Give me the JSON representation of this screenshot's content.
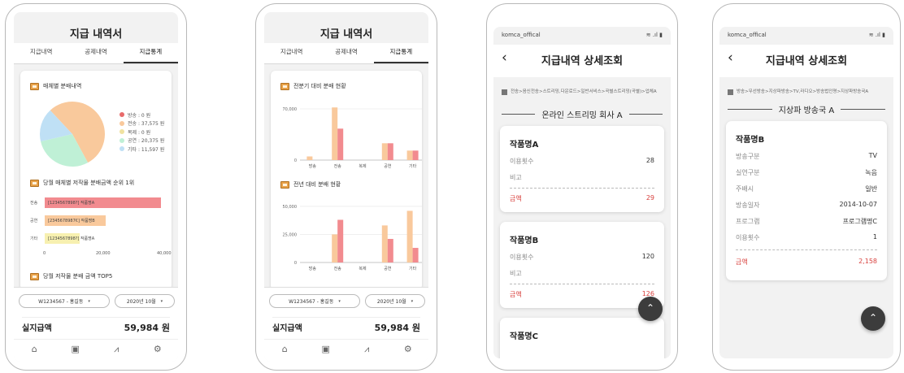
{
  "colors": {
    "accent_red": "#d8413e",
    "bar_orange": "#f9c99c",
    "bar_pink": "#f28b8f",
    "pie_red": "#e86a6a",
    "pie_orange": "#f9c99c",
    "pie_green": "#bff0d6",
    "pie_blue": "#bfe0f5",
    "fab": "#3c3c3c"
  },
  "stats_screen": {
    "title": "지급 내역서",
    "tabs": [
      "지급내역",
      "공제내역",
      "지급통계"
    ],
    "active_tab": "지급통계",
    "footer": {
      "member_select": "W1234567 - 홍길동",
      "month_select": "2020년 10월",
      "total_label": "실지급액",
      "total_value": "59,984 원"
    },
    "nav_icons": [
      "home-icon",
      "document-icon",
      "chart-icon",
      "gear-icon"
    ]
  },
  "stats_a": {
    "sec1": "매체별 분배내역",
    "sec2": "당월 매체별 저작물 분배금액 순위 1위",
    "sec3": "당월 저작물 분배 금액 TOP5",
    "pie_legend": [
      "방송 : 0 원",
      "전송 : 37,575 원",
      "복제 : 0 원",
      "공연 : 20,375 원",
      "기타 : 11,597 원"
    ],
    "hbars": [
      {
        "label": "전송",
        "text": "[1234567898?] 작품명A"
      },
      {
        "label": "공연",
        "text": "[2345678987€] 작품명B"
      },
      {
        "label": "기타",
        "text": "[1234567898?] 작품명A"
      }
    ],
    "hbar_ticks": [
      "0",
      "20,000",
      "40,000"
    ]
  },
  "stats_b": {
    "sec1": "전분기 대비 분배 현황",
    "sec2": "전년 대비 분배 현황",
    "chart1_ticks": [
      "70,000",
      "0"
    ],
    "chart2_ticks": [
      "50,000",
      "25,000",
      "0"
    ],
    "categories": [
      "방송",
      "전송",
      "복제",
      "공연",
      "기타"
    ]
  },
  "chart_data": [
    {
      "type": "pie",
      "title": "매체별 분배내역",
      "categories": [
        "방송",
        "전송",
        "복제",
        "공연",
        "기타"
      ],
      "values": [
        0,
        37575,
        0,
        20375,
        11597
      ]
    },
    {
      "type": "bar",
      "orientation": "horizontal",
      "title": "당월 매체별 저작물 분배금액 순위 1위",
      "categories": [
        "전송",
        "공연",
        "기타"
      ],
      "values": [
        38000,
        20000,
        11500
      ],
      "xlim": [
        0,
        40000
      ]
    },
    {
      "type": "bar",
      "title": "전분기 대비 분배 현황",
      "categories": [
        "방송",
        "전송",
        "복제",
        "공연",
        "기타"
      ],
      "series": [
        {
          "values": [
            5000,
            72000,
            0,
            23000,
            13000
          ]
        },
        {
          "values": [
            0,
            43000,
            0,
            23000,
            13000
          ]
        }
      ],
      "ylim": [
        0,
        80000
      ]
    },
    {
      "type": "bar",
      "title": "전년 대비 분배 현황",
      "categories": [
        "방송",
        "전송",
        "복제",
        "공연",
        "기타"
      ],
      "series": [
        {
          "values": [
            0,
            25000,
            0,
            33000,
            46000
          ]
        },
        {
          "values": [
            0,
            38000,
            0,
            21000,
            13000
          ]
        }
      ],
      "ylim": [
        0,
        55000
      ]
    }
  ],
  "detail_common": {
    "status_left": "komca_offical",
    "status_right": "≋ .ıl ▮",
    "title": "지급내역 상세조회",
    "back": "‹",
    "fab": "⌃"
  },
  "detail_a": {
    "crumb": "전송>음신전송>스트리밍,다운로드>일반서비스>곡별스트리밍(곡별)>업체A",
    "company": "온라인 스트리밍 회사 A",
    "cards": [
      {
        "title": "작품명A",
        "rows": [
          {
            "k": "이용횟수",
            "v": "28"
          },
          {
            "k": "비고",
            "v": ""
          }
        ],
        "amount_label": "금액",
        "amount": "29"
      },
      {
        "title": "작품명B",
        "rows": [
          {
            "k": "이용횟수",
            "v": "120"
          },
          {
            "k": "비고",
            "v": ""
          }
        ],
        "amount_label": "금액",
        "amount": "126"
      }
    ],
    "partial_card_title": "작품명C"
  },
  "detail_b": {
    "crumb": "방송>무선방송>지상파방송>TV,라디오>방송법인명>지상파방송국A",
    "company": "지상파 방송국 A",
    "card": {
      "title": "작품명B",
      "rows": [
        {
          "k": "방송구분",
          "v": "TV"
        },
        {
          "k": "실연구분",
          "v": "녹음"
        },
        {
          "k": "주배시",
          "v": "일반"
        },
        {
          "k": "방송일자",
          "v": "2014-10-07"
        },
        {
          "k": "프로그램",
          "v": "프로그램명C"
        },
        {
          "k": "이용횟수",
          "v": "1"
        }
      ],
      "amount_label": "금액",
      "amount": "2,158"
    }
  }
}
